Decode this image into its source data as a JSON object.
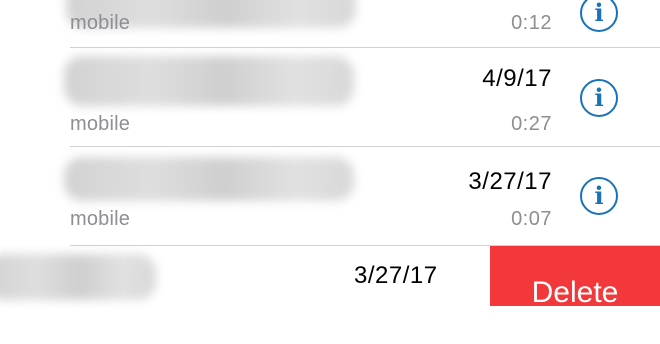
{
  "recents": [
    {
      "date": "",
      "label": "mobile",
      "duration": "0:12",
      "info_icon": "info-icon",
      "info_glyph": "i"
    },
    {
      "date": "4/9/17",
      "label": "mobile",
      "duration": "0:27",
      "info_icon": "info-icon",
      "info_glyph": "i"
    },
    {
      "date": "3/27/17",
      "label": "mobile",
      "duration": "0:07",
      "info_icon": "info-icon",
      "info_glyph": "i"
    },
    {
      "date": "3/27/17",
      "label": "",
      "duration": ""
    }
  ],
  "swipe_action": {
    "delete_label": "Delete"
  },
  "colors": {
    "info_blue": "#1a72b8",
    "secondary_gray": "#8e8e93",
    "delete_red": "#f2383a",
    "separator": "#d0d0d4"
  }
}
